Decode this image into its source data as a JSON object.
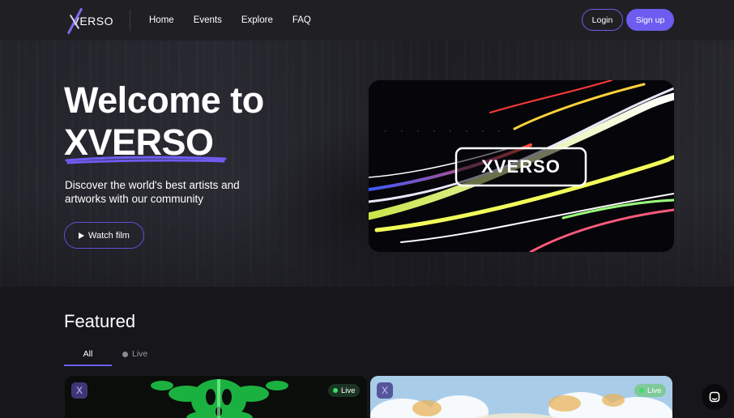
{
  "nav": {
    "logo_text": "VERSO",
    "links": [
      "Home",
      "Events",
      "Explore",
      "FAQ"
    ],
    "login_label": "Login",
    "signup_label": "Sign up"
  },
  "hero": {
    "title_line1": "Welcome to",
    "title_line2": "XVERSO",
    "subtitle": "Discover the world's best artists and artworks with our community",
    "watch_label": "Watch film",
    "video_logo_text": "XVERSO"
  },
  "featured": {
    "title": "Featured",
    "tab_all": "All",
    "tab_live": "Live",
    "cards": [
      {
        "badge": "X",
        "status": "Live"
      },
      {
        "badge": "X",
        "status": "Live"
      }
    ]
  },
  "colors": {
    "accent": "#6e5cf0",
    "live_green": "#3ddc6a",
    "background": "#17171b",
    "nav": "#202024"
  },
  "icons": [
    "x-logo-icon",
    "play-icon",
    "chat-icon"
  ]
}
